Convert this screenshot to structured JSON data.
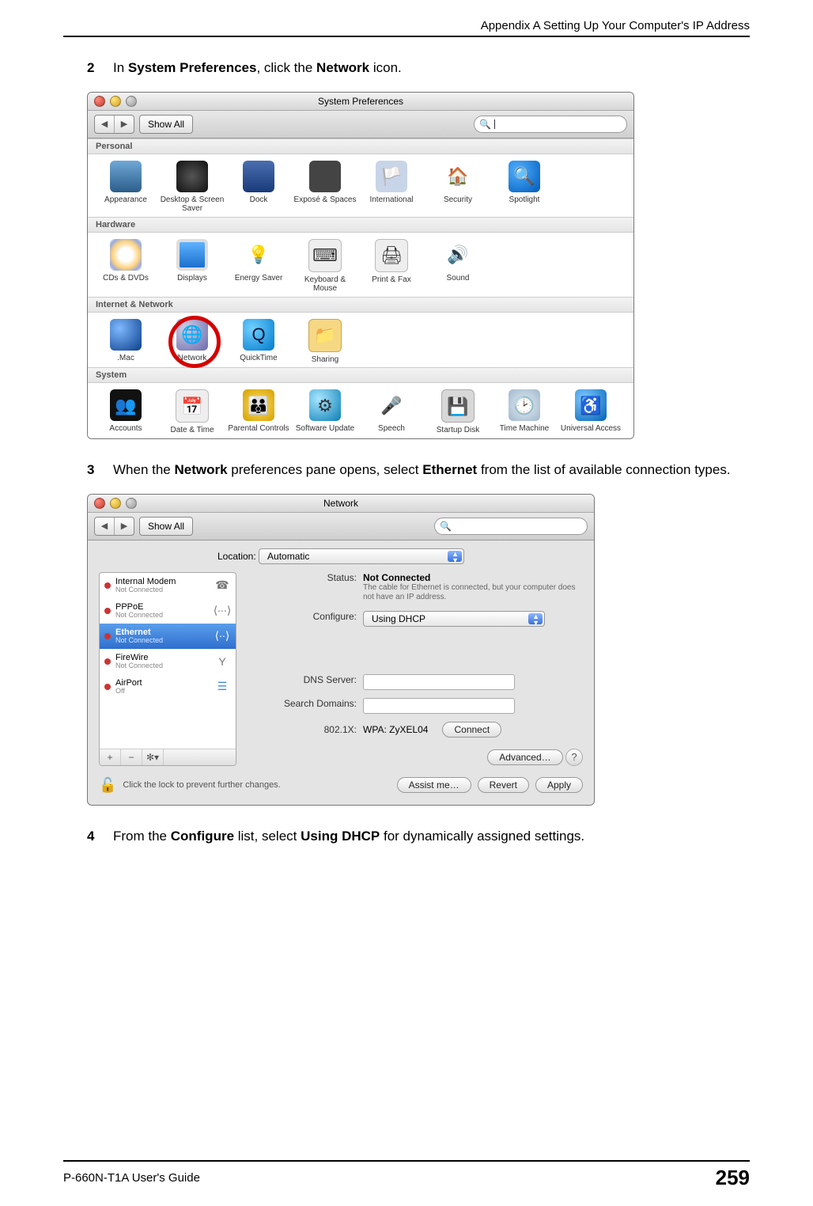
{
  "header": {
    "appendix": "Appendix A Setting Up Your Computer's IP Address"
  },
  "footer": {
    "guide": "P-660N-T1A User's Guide",
    "page": "259"
  },
  "steps": {
    "s2": {
      "num": "2",
      "pre": "In ",
      "bold1": "System Preferences",
      "mid": ", click the ",
      "bold2": "Network",
      "post": " icon."
    },
    "s3": {
      "num": "3",
      "pre": "When the ",
      "bold1": "Network",
      "mid": " preferences pane opens, select ",
      "bold2": "Ethernet",
      "post": " from the list of available connection types."
    },
    "s4": {
      "num": "4",
      "pre": "From the ",
      "bold1": "Configure",
      "mid": " list, select ",
      "bold2": "Using DHCP",
      "post": " for dynamically assigned settings."
    }
  },
  "sp": {
    "title": "System Preferences",
    "show_all": "Show All",
    "sections": {
      "personal": {
        "label": "Personal",
        "items": [
          "Appearance",
          "Desktop & Screen Saver",
          "Dock",
          "Exposé & Spaces",
          "International",
          "Security",
          "Spotlight"
        ]
      },
      "hardware": {
        "label": "Hardware",
        "items": [
          "CDs & DVDs",
          "Displays",
          "Energy Saver",
          "Keyboard & Mouse",
          "Print & Fax",
          "Sound"
        ]
      },
      "internet": {
        "label": "Internet & Network",
        "items": [
          ".Mac",
          "Network",
          "QuickTime",
          "Sharing"
        ]
      },
      "system": {
        "label": "System",
        "items": [
          "Accounts",
          "Date & Time",
          "Parental Controls",
          "Software Update",
          "Speech",
          "Startup Disk",
          "Time Machine",
          "Universal Access"
        ]
      }
    }
  },
  "net": {
    "title": "Network",
    "show_all": "Show All",
    "location_label": "Location:",
    "location_value": "Automatic",
    "services": [
      {
        "name": "Internal Modem",
        "sub": "Not Connected",
        "icon": "☎"
      },
      {
        "name": "PPPoE",
        "sub": "Not Connected",
        "icon": "⟨∙∙∙⟩"
      },
      {
        "name": "Ethernet",
        "sub": "Not Connected",
        "icon": "⟨∙∙⟩",
        "selected": true
      },
      {
        "name": "FireWire",
        "sub": "Not Connected",
        "icon": "Y"
      },
      {
        "name": "AirPort",
        "sub": "Off",
        "icon": "☰"
      }
    ],
    "tools": {
      "add": "+",
      "remove": "−",
      "gear": "✻▾"
    },
    "labels": {
      "status": "Status:",
      "configure": "Configure:",
      "dns": "DNS Server:",
      "search": "Search Domains:",
      "dot1x": "802.1X:"
    },
    "status_value": "Not Connected",
    "status_hint": "The cable for Ethernet is connected, but your computer does not have an IP address.",
    "configure_value": "Using DHCP",
    "dot1x_value": "WPA: ZyXEL04",
    "buttons": {
      "connect": "Connect",
      "advanced": "Advanced…",
      "help": "?",
      "assist": "Assist me…",
      "revert": "Revert",
      "apply": "Apply"
    },
    "lock_text": "Click the lock to prevent further changes."
  }
}
